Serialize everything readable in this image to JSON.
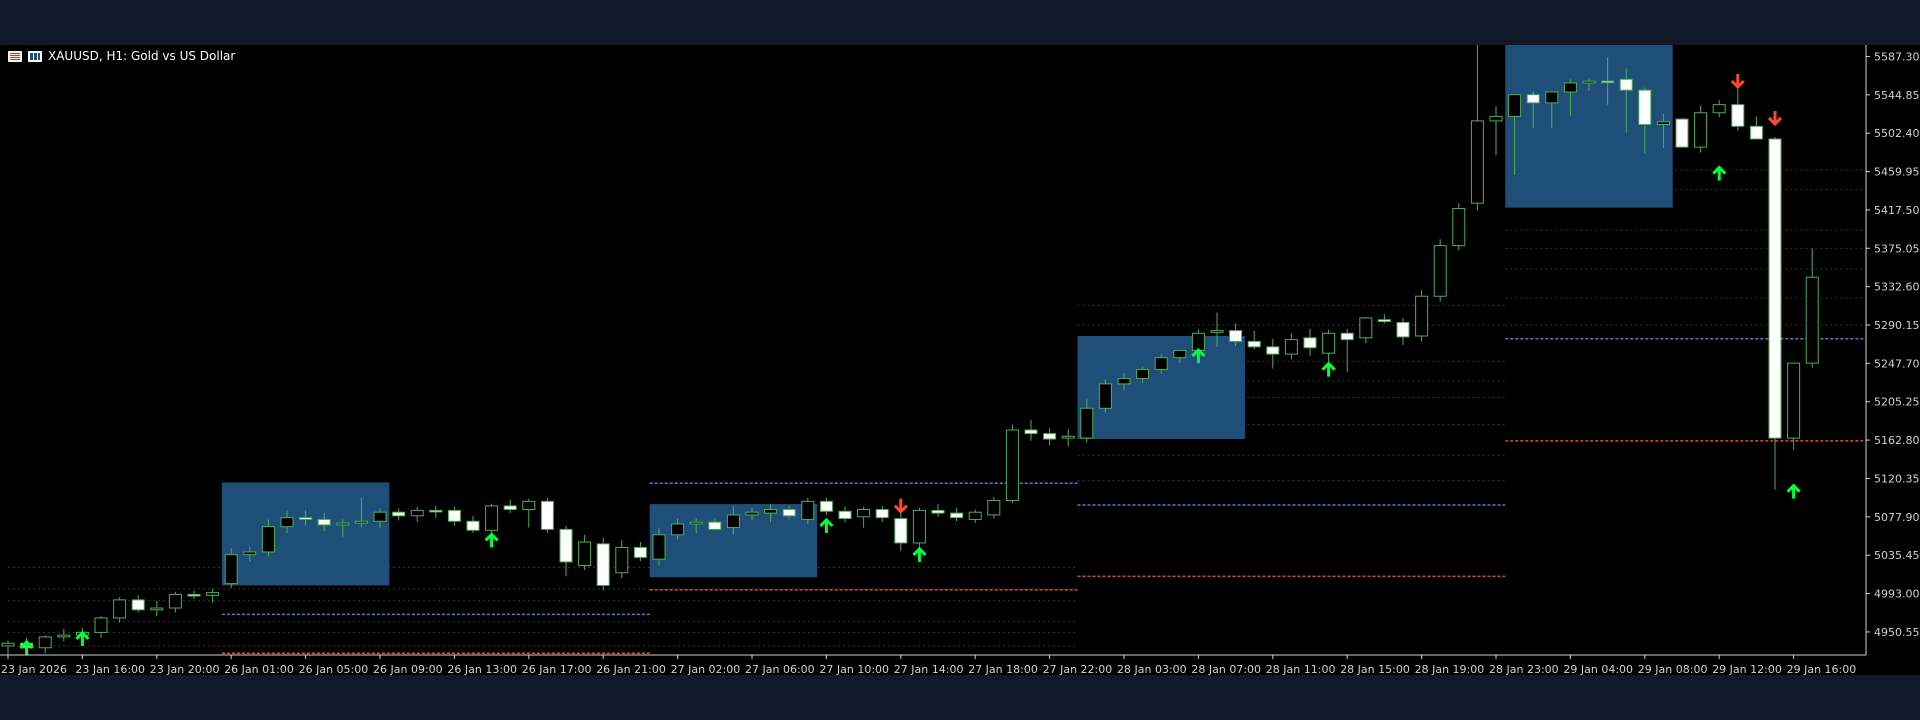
{
  "header": {
    "title": "XAUUSD, H1:  Gold vs US Dollar",
    "icons": [
      "one-click-trading-icon",
      "chart-bars-icon"
    ]
  },
  "colors": {
    "background": "#000000",
    "bull_body": "#000000",
    "bear_body": "#ffffff",
    "wick": "#4caf50",
    "zone": "#1f4e79",
    "grid": "#2e3a2e",
    "level_blue": "#4a7fd6",
    "level_red": "#e04a3a",
    "up_arrow": "#00ff3c",
    "down_arrow": "#ff4a2a",
    "axis_text": "#d0d0d0"
  },
  "chart_data": {
    "type": "candlestick",
    "symbol": "XAUUSD",
    "timeframe": "H1",
    "description": "Gold vs US Dollar",
    "ylim": [
      4925,
      5600
    ],
    "y_ticks": [
      5587.3,
      5544.85,
      5502.4,
      5459.95,
      5417.5,
      5375.05,
      5332.6,
      5290.15,
      5247.7,
      5205.25,
      5162.8,
      5120.35,
      5077.9,
      5035.45,
      4993.0,
      4950.55
    ],
    "x_tick_labels": [
      "23 Jan 2026",
      "23 Jan 16:00",
      "23 Jan 20:00",
      "26 Jan 01:00",
      "26 Jan 05:00",
      "26 Jan 09:00",
      "26 Jan 13:00",
      "26 Jan 17:00",
      "26 Jan 21:00",
      "27 Jan 02:00",
      "27 Jan 06:00",
      "27 Jan 10:00",
      "27 Jan 14:00",
      "27 Jan 18:00",
      "27 Jan 22:00",
      "28 Jan 03:00",
      "28 Jan 07:00",
      "28 Jan 11:00",
      "28 Jan 15:00",
      "28 Jan 19:00",
      "28 Jan 23:00",
      "29 Jan 04:00",
      "29 Jan 08:00",
      "29 Jan 12:00",
      "29 Jan 16:00"
    ],
    "x_tick_bar_index": [
      0,
      4,
      8,
      12,
      16,
      20,
      24,
      28,
      32,
      36,
      40,
      44,
      48,
      52,
      56,
      60,
      64,
      68,
      72,
      76,
      80,
      84,
      88,
      92,
      96
    ],
    "candles": [
      {
        "o": 4935,
        "h": 4941,
        "l": 4926,
        "c": 4938
      },
      {
        "o": 4938,
        "h": 4944,
        "l": 4930,
        "c": 4933
      },
      {
        "o": 4933,
        "h": 4947,
        "l": 4927,
        "c": 4945
      },
      {
        "o": 4945,
        "h": 4954,
        "l": 4940,
        "c": 4947
      },
      {
        "o": 4947,
        "h": 4955,
        "l": 4939,
        "c": 4950
      },
      {
        "o": 4950,
        "h": 4968,
        "l": 4944,
        "c": 4966
      },
      {
        "o": 4966,
        "h": 4989,
        "l": 4961,
        "c": 4986
      },
      {
        "o": 4986,
        "h": 4991,
        "l": 4972,
        "c": 4975
      },
      {
        "o": 4975,
        "h": 4985,
        "l": 4968,
        "c": 4977
      },
      {
        "o": 4977,
        "h": 4995,
        "l": 4972,
        "c": 4992
      },
      {
        "o": 4992,
        "h": 4996,
        "l": 4987,
        "c": 4991
      },
      {
        "o": 4991,
        "h": 4998,
        "l": 4983,
        "c": 4994
      },
      {
        "o": 5004,
        "h": 5043,
        "l": 4999,
        "c": 5036
      },
      {
        "o": 5036,
        "h": 5045,
        "l": 5028,
        "c": 5039
      },
      {
        "o": 5039,
        "h": 5075,
        "l": 5034,
        "c": 5067
      },
      {
        "o": 5067,
        "h": 5085,
        "l": 5060,
        "c": 5077
      },
      {
        "o": 5077,
        "h": 5085,
        "l": 5068,
        "c": 5075
      },
      {
        "o": 5075,
        "h": 5082,
        "l": 5062,
        "c": 5069
      },
      {
        "o": 5069,
        "h": 5075,
        "l": 5056,
        "c": 5071
      },
      {
        "o": 5071,
        "h": 5099,
        "l": 5066,
        "c": 5073
      },
      {
        "o": 5073,
        "h": 5087,
        "l": 5066,
        "c": 5083
      },
      {
        "o": 5083,
        "h": 5087,
        "l": 5074,
        "c": 5079
      },
      {
        "o": 5079,
        "h": 5089,
        "l": 5072,
        "c": 5085
      },
      {
        "o": 5085,
        "h": 5090,
        "l": 5077,
        "c": 5084
      },
      {
        "o": 5085,
        "h": 5089,
        "l": 5068,
        "c": 5073
      },
      {
        "o": 5073,
        "h": 5079,
        "l": 5060,
        "c": 5063
      },
      {
        "o": 5063,
        "h": 5092,
        "l": 5052,
        "c": 5090
      },
      {
        "o": 5090,
        "h": 5097,
        "l": 5082,
        "c": 5086
      },
      {
        "o": 5086,
        "h": 5098,
        "l": 5066,
        "c": 5095
      },
      {
        "o": 5095,
        "h": 5099,
        "l": 5060,
        "c": 5064
      },
      {
        "o": 5064,
        "h": 5068,
        "l": 5012,
        "c": 5028
      },
      {
        "o": 5024,
        "h": 5058,
        "l": 5019,
        "c": 5050
      },
      {
        "o": 5048,
        "h": 5055,
        "l": 4996,
        "c": 5002
      },
      {
        "o": 5016,
        "h": 5052,
        "l": 5010,
        "c": 5044
      },
      {
        "o": 5044,
        "h": 5050,
        "l": 5029,
        "c": 5033
      },
      {
        "o": 5031,
        "h": 5066,
        "l": 5024,
        "c": 5058
      },
      {
        "o": 5058,
        "h": 5076,
        "l": 5053,
        "c": 5070
      },
      {
        "o": 5070,
        "h": 5076,
        "l": 5060,
        "c": 5072
      },
      {
        "o": 5072,
        "h": 5076,
        "l": 5063,
        "c": 5064
      },
      {
        "o": 5066,
        "h": 5090,
        "l": 5058,
        "c": 5080
      },
      {
        "o": 5080,
        "h": 5088,
        "l": 5074,
        "c": 5083
      },
      {
        "o": 5082,
        "h": 5092,
        "l": 5072,
        "c": 5086
      },
      {
        "o": 5086,
        "h": 5090,
        "l": 5075,
        "c": 5079
      },
      {
        "o": 5075,
        "h": 5099,
        "l": 5070,
        "c": 5095
      },
      {
        "o": 5095,
        "h": 5099,
        "l": 5080,
        "c": 5084
      },
      {
        "o": 5084,
        "h": 5089,
        "l": 5072,
        "c": 5076
      },
      {
        "o": 5078,
        "h": 5089,
        "l": 5066,
        "c": 5086
      },
      {
        "o": 5086,
        "h": 5090,
        "l": 5072,
        "c": 5077
      },
      {
        "o": 5076,
        "h": 5084,
        "l": 5040,
        "c": 5049
      },
      {
        "o": 5049,
        "h": 5088,
        "l": 5037,
        "c": 5085
      },
      {
        "o": 5085,
        "h": 5092,
        "l": 5078,
        "c": 5082
      },
      {
        "o": 5082,
        "h": 5088,
        "l": 5073,
        "c": 5077
      },
      {
        "o": 5075,
        "h": 5086,
        "l": 5071,
        "c": 5083
      },
      {
        "o": 5080,
        "h": 5100,
        "l": 5076,
        "c": 5096
      },
      {
        "o": 5096,
        "h": 5180,
        "l": 5093,
        "c": 5174
      },
      {
        "o": 5174,
        "h": 5185,
        "l": 5162,
        "c": 5170
      },
      {
        "o": 5170,
        "h": 5176,
        "l": 5157,
        "c": 5164
      },
      {
        "o": 5165,
        "h": 5175,
        "l": 5156,
        "c": 5167
      },
      {
        "o": 5165,
        "h": 5208,
        "l": 5160,
        "c": 5198
      },
      {
        "o": 5198,
        "h": 5230,
        "l": 5193,
        "c": 5225
      },
      {
        "o": 5225,
        "h": 5237,
        "l": 5218,
        "c": 5231
      },
      {
        "o": 5231,
        "h": 5244,
        "l": 5226,
        "c": 5241
      },
      {
        "o": 5241,
        "h": 5258,
        "l": 5236,
        "c": 5254
      },
      {
        "o": 5254,
        "h": 5263,
        "l": 5248,
        "c": 5262
      },
      {
        "o": 5262,
        "h": 5285,
        "l": 5258,
        "c": 5281
      },
      {
        "o": 5282,
        "h": 5304,
        "l": 5266,
        "c": 5284
      },
      {
        "o": 5284,
        "h": 5292,
        "l": 5267,
        "c": 5272
      },
      {
        "o": 5272,
        "h": 5284,
        "l": 5263,
        "c": 5266
      },
      {
        "o": 5266,
        "h": 5275,
        "l": 5242,
        "c": 5258
      },
      {
        "o": 5258,
        "h": 5281,
        "l": 5252,
        "c": 5274
      },
      {
        "o": 5276,
        "h": 5286,
        "l": 5256,
        "c": 5265
      },
      {
        "o": 5259,
        "h": 5285,
        "l": 5248,
        "c": 5281
      },
      {
        "o": 5281,
        "h": 5286,
        "l": 5238,
        "c": 5274
      },
      {
        "o": 5276,
        "h": 5299,
        "l": 5270,
        "c": 5298
      },
      {
        "o": 5296,
        "h": 5302,
        "l": 5292,
        "c": 5294
      },
      {
        "o": 5293,
        "h": 5298,
        "l": 5268,
        "c": 5277
      },
      {
        "o": 5278,
        "h": 5329,
        "l": 5272,
        "c": 5322
      },
      {
        "o": 5322,
        "h": 5385,
        "l": 5316,
        "c": 5378
      },
      {
        "o": 5378,
        "h": 5425,
        "l": 5373,
        "c": 5419
      },
      {
        "o": 5425,
        "h": 5600,
        "l": 5417,
        "c": 5516
      },
      {
        "o": 5516,
        "h": 5532,
        "l": 5478,
        "c": 5521
      },
      {
        "o": 5521,
        "h": 5545,
        "l": 5456,
        "c": 5545
      },
      {
        "o": 5545,
        "h": 5549,
        "l": 5508,
        "c": 5536
      },
      {
        "o": 5536,
        "h": 5544,
        "l": 5508,
        "c": 5548
      },
      {
        "o": 5548,
        "h": 5562,
        "l": 5521,
        "c": 5558
      },
      {
        "o": 5558,
        "h": 5563,
        "l": 5549,
        "c": 5560
      },
      {
        "o": 5560,
        "h": 5586,
        "l": 5534,
        "c": 5559
      },
      {
        "o": 5562,
        "h": 5574,
        "l": 5503,
        "c": 5550
      },
      {
        "o": 5550,
        "h": 5553,
        "l": 5480,
        "c": 5512
      },
      {
        "o": 5512,
        "h": 5524,
        "l": 5486,
        "c": 5515
      },
      {
        "o": 5518,
        "h": 5519,
        "l": 5488,
        "c": 5487
      },
      {
        "o": 5487,
        "h": 5533,
        "l": 5481,
        "c": 5525
      },
      {
        "o": 5525,
        "h": 5539,
        "l": 5520,
        "c": 5534
      },
      {
        "o": 5534,
        "h": 5553,
        "l": 5505,
        "c": 5510
      },
      {
        "o": 5510,
        "h": 5521,
        "l": 5503,
        "c": 5496
      },
      {
        "o": 5496,
        "h": 5498,
        "l": 5108,
        "c": 5165
      },
      {
        "o": 5165,
        "h": 5214,
        "l": 5152,
        "c": 5248
      },
      {
        "o": 5248,
        "h": 5375,
        "l": 5243,
        "c": 5343
      }
    ],
    "zones": [
      {
        "from": 11.5,
        "to": 20.5,
        "top": 5116,
        "bottom": 5002
      },
      {
        "from": 34.5,
        "to": 43.5,
        "top": 5092,
        "bottom": 5011
      },
      {
        "from": 57.5,
        "to": 66.5,
        "top": 5278,
        "bottom": 5164
      },
      {
        "from": 80.5,
        "to": 89.5,
        "top": 5600,
        "bottom": 5420
      }
    ],
    "levels": [
      {
        "price": 4970,
        "from": 11.5,
        "to": 34.5,
        "color": "blue"
      },
      {
        "price": 4927,
        "from": 11.5,
        "to": 34.5,
        "color": "red"
      },
      {
        "price": 5115,
        "from": 34.5,
        "to": 57.5,
        "color": "blue"
      },
      {
        "price": 4997,
        "from": 34.5,
        "to": 57.5,
        "color": "red"
      },
      {
        "price": 5091,
        "from": 57.5,
        "to": 80.5,
        "color": "blue"
      },
      {
        "price": 5012,
        "from": 57.5,
        "to": 80.5,
        "color": "red"
      },
      {
        "price": 5275,
        "from": 80.5,
        "to": 101,
        "color": "blue"
      },
      {
        "price": 5162,
        "from": 80.5,
        "to": 101,
        "color": "red"
      }
    ],
    "faint_levels": [
      {
        "from": 0,
        "to": 57.5,
        "prices": [
          5022,
          4998,
          4985,
          4962,
          4950,
          4935
        ]
      },
      {
        "from": 57.5,
        "to": 80.5,
        "prices": [
          5312,
          5290,
          5250,
          5228,
          5210,
          5180,
          5146,
          5118
        ]
      },
      {
        "from": 80.5,
        "to": 101,
        "prices": [
          5462,
          5440,
          5395,
          5375,
          5352,
          5320,
          5290
        ]
      }
    ],
    "signals": [
      {
        "bar": 1,
        "dir": "up",
        "price": 4925
      },
      {
        "bar": 4,
        "dir": "up",
        "price": 4935
      },
      {
        "bar": 26,
        "dir": "up",
        "price": 5044
      },
      {
        "bar": 44,
        "dir": "up",
        "price": 5060
      },
      {
        "bar": 49,
        "dir": "up",
        "price": 5028
      },
      {
        "bar": 64,
        "dir": "up",
        "price": 5248
      },
      {
        "bar": 71,
        "dir": "up",
        "price": 5233
      },
      {
        "bar": 92,
        "dir": "up",
        "price": 5450
      },
      {
        "bar": 96,
        "dir": "up",
        "price": 5098
      },
      {
        "bar": 48,
        "dir": "down",
        "price": 5098
      },
      {
        "bar": 93,
        "dir": "down",
        "price": 5568
      },
      {
        "bar": 95,
        "dir": "down",
        "price": 5527
      }
    ]
  }
}
